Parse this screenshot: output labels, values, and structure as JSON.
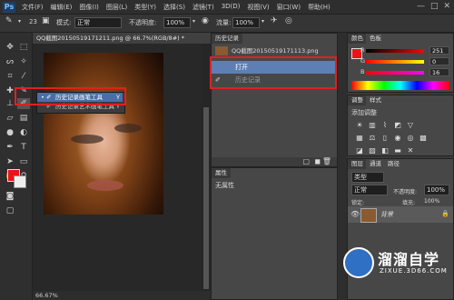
{
  "app": {
    "logo": "Ps",
    "menus": [
      "文件(F)",
      "编辑(E)",
      "图像(I)",
      "图层(L)",
      "类型(Y)",
      "选择(S)",
      "滤镜(T)",
      "3D(D)",
      "视图(V)",
      "窗口(W)",
      "帮助(H)"
    ],
    "window_controls": [
      "—",
      "□",
      "✕"
    ]
  },
  "options_bar": {
    "brush_size": "23",
    "mode_label": "模式:",
    "mode_value": "正常",
    "opacity_label": "不透明度:",
    "opacity_value": "100%",
    "flow_label": "流量:",
    "flow_value": "100%"
  },
  "document": {
    "tab_title": "QQ截图20150519171211.png @ 66.7%(RGB/8#) *",
    "zoom": "66.67%"
  },
  "flyout": {
    "items": [
      {
        "label": "历史记录画笔工具",
        "shortcut": "Y"
      },
      {
        "label": "历史记录艺术画笔工具",
        "shortcut": "Y"
      }
    ]
  },
  "history_panel": {
    "tab": "历史记录",
    "snapshot": "QQ截图20150519171113.png",
    "rows": [
      "打开",
      "历史记录"
    ]
  },
  "properties_panel": {
    "tab": "属性",
    "text": "无属性"
  },
  "color_panel": {
    "tabs": [
      "颜色",
      "色板"
    ],
    "channels": [
      {
        "label": "R",
        "value": "251"
      },
      {
        "label": "G",
        "value": "0"
      },
      {
        "label": "B",
        "value": "16"
      }
    ],
    "fg_color": "#e8141a",
    "bg_color": "#ffffff"
  },
  "adjustments_panel": {
    "tabs": [
      "调整",
      "样式"
    ],
    "title": "添加调整"
  },
  "layers_panel": {
    "tabs": [
      "图层",
      "通道",
      "路径"
    ],
    "kind_label": "类型",
    "blend_mode": "正常",
    "opacity_label": "不透明度:",
    "opacity_value": "100%",
    "lock_label": "锁定:",
    "fill_label": "填充:",
    "fill_value": "100%",
    "layer_name": "背景"
  },
  "watermark": {
    "brand": "溜溜自学",
    "url": "ZIXUE.3D66.COM"
  }
}
